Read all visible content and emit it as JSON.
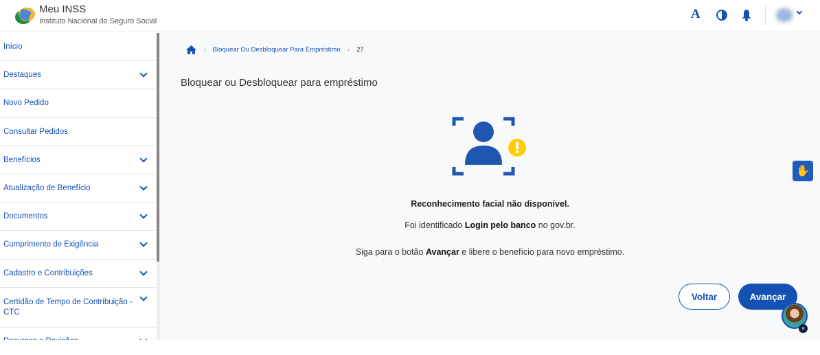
{
  "header": {
    "title": "Meu INSS",
    "subtitle": "Instituto Nacional do Seguro Social",
    "font_icon": "A"
  },
  "sidebar": {
    "items": [
      {
        "label": "Início",
        "expandable": false
      },
      {
        "label": "Destaques",
        "expandable": true
      },
      {
        "label": "Novo Pedido",
        "expandable": false
      },
      {
        "label": "Consultar Pedidos",
        "expandable": false
      },
      {
        "label": "Benefícios",
        "expandable": true
      },
      {
        "label": "Atualização de Benefício",
        "expandable": true
      },
      {
        "label": "Documentos",
        "expandable": true
      },
      {
        "label": "Cumprimento de Exigência",
        "expandable": true
      },
      {
        "label": "Cadastro e Contribuições",
        "expandable": true
      },
      {
        "label": "Certidão de Tempo de Contribuição - CTC",
        "expandable": true
      },
      {
        "label": "Recursos e Revisões",
        "expandable": true
      }
    ]
  },
  "breadcrumb": {
    "items": [
      "Bloquear Ou Desbloquear Para Empréstimo",
      "27"
    ]
  },
  "main": {
    "title": "Bloquear ou Desbloquear para empréstimo",
    "heading": "Reconhecimento facial não disponível.",
    "line1_pre": "Foi identificado ",
    "line1_bold": "Login pelo banco",
    "line1_post": " no gov.br.",
    "line2_pre": "Siga para o botão ",
    "line2_bold": "Avançar",
    "line2_post": " e libere o benefício para novo empréstimo.",
    "back_label": "Voltar",
    "next_label": "Avançar"
  },
  "colors": {
    "primary": "#1351b4",
    "warning": "#ffcd07"
  }
}
